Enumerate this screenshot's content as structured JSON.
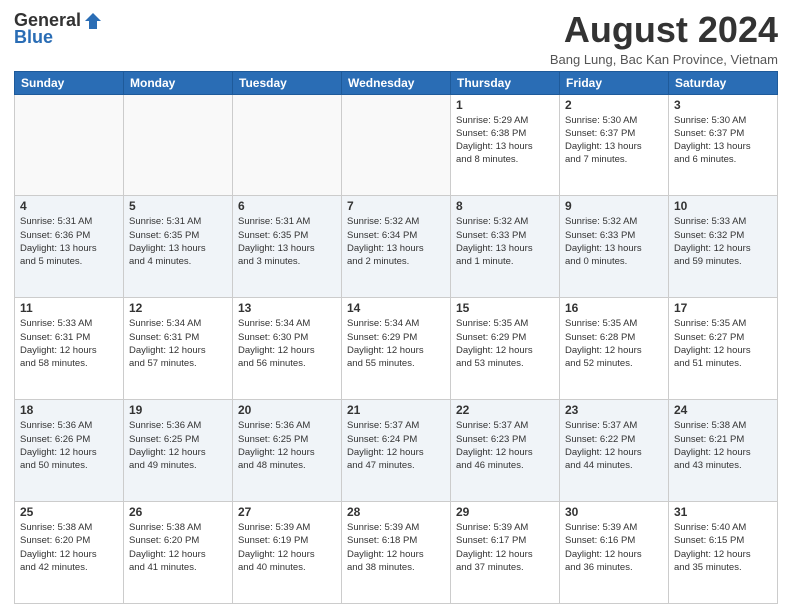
{
  "logo": {
    "general": "General",
    "blue": "Blue"
  },
  "header": {
    "month_year": "August 2024",
    "location": "Bang Lung, Bac Kan Province, Vietnam"
  },
  "days_of_week": [
    "Sunday",
    "Monday",
    "Tuesday",
    "Wednesday",
    "Thursday",
    "Friday",
    "Saturday"
  ],
  "weeks": [
    [
      {
        "num": "",
        "info": ""
      },
      {
        "num": "",
        "info": ""
      },
      {
        "num": "",
        "info": ""
      },
      {
        "num": "",
        "info": ""
      },
      {
        "num": "1",
        "info": "Sunrise: 5:29 AM\nSunset: 6:38 PM\nDaylight: 13 hours\nand 8 minutes."
      },
      {
        "num": "2",
        "info": "Sunrise: 5:30 AM\nSunset: 6:37 PM\nDaylight: 13 hours\nand 7 minutes."
      },
      {
        "num": "3",
        "info": "Sunrise: 5:30 AM\nSunset: 6:37 PM\nDaylight: 13 hours\nand 6 minutes."
      }
    ],
    [
      {
        "num": "4",
        "info": "Sunrise: 5:31 AM\nSunset: 6:36 PM\nDaylight: 13 hours\nand 5 minutes."
      },
      {
        "num": "5",
        "info": "Sunrise: 5:31 AM\nSunset: 6:35 PM\nDaylight: 13 hours\nand 4 minutes."
      },
      {
        "num": "6",
        "info": "Sunrise: 5:31 AM\nSunset: 6:35 PM\nDaylight: 13 hours\nand 3 minutes."
      },
      {
        "num": "7",
        "info": "Sunrise: 5:32 AM\nSunset: 6:34 PM\nDaylight: 13 hours\nand 2 minutes."
      },
      {
        "num": "8",
        "info": "Sunrise: 5:32 AM\nSunset: 6:33 PM\nDaylight: 13 hours\nand 1 minute."
      },
      {
        "num": "9",
        "info": "Sunrise: 5:32 AM\nSunset: 6:33 PM\nDaylight: 13 hours\nand 0 minutes."
      },
      {
        "num": "10",
        "info": "Sunrise: 5:33 AM\nSunset: 6:32 PM\nDaylight: 12 hours\nand 59 minutes."
      }
    ],
    [
      {
        "num": "11",
        "info": "Sunrise: 5:33 AM\nSunset: 6:31 PM\nDaylight: 12 hours\nand 58 minutes."
      },
      {
        "num": "12",
        "info": "Sunrise: 5:34 AM\nSunset: 6:31 PM\nDaylight: 12 hours\nand 57 minutes."
      },
      {
        "num": "13",
        "info": "Sunrise: 5:34 AM\nSunset: 6:30 PM\nDaylight: 12 hours\nand 56 minutes."
      },
      {
        "num": "14",
        "info": "Sunrise: 5:34 AM\nSunset: 6:29 PM\nDaylight: 12 hours\nand 55 minutes."
      },
      {
        "num": "15",
        "info": "Sunrise: 5:35 AM\nSunset: 6:29 PM\nDaylight: 12 hours\nand 53 minutes."
      },
      {
        "num": "16",
        "info": "Sunrise: 5:35 AM\nSunset: 6:28 PM\nDaylight: 12 hours\nand 52 minutes."
      },
      {
        "num": "17",
        "info": "Sunrise: 5:35 AM\nSunset: 6:27 PM\nDaylight: 12 hours\nand 51 minutes."
      }
    ],
    [
      {
        "num": "18",
        "info": "Sunrise: 5:36 AM\nSunset: 6:26 PM\nDaylight: 12 hours\nand 50 minutes."
      },
      {
        "num": "19",
        "info": "Sunrise: 5:36 AM\nSunset: 6:25 PM\nDaylight: 12 hours\nand 49 minutes."
      },
      {
        "num": "20",
        "info": "Sunrise: 5:36 AM\nSunset: 6:25 PM\nDaylight: 12 hours\nand 48 minutes."
      },
      {
        "num": "21",
        "info": "Sunrise: 5:37 AM\nSunset: 6:24 PM\nDaylight: 12 hours\nand 47 minutes."
      },
      {
        "num": "22",
        "info": "Sunrise: 5:37 AM\nSunset: 6:23 PM\nDaylight: 12 hours\nand 46 minutes."
      },
      {
        "num": "23",
        "info": "Sunrise: 5:37 AM\nSunset: 6:22 PM\nDaylight: 12 hours\nand 44 minutes."
      },
      {
        "num": "24",
        "info": "Sunrise: 5:38 AM\nSunset: 6:21 PM\nDaylight: 12 hours\nand 43 minutes."
      }
    ],
    [
      {
        "num": "25",
        "info": "Sunrise: 5:38 AM\nSunset: 6:20 PM\nDaylight: 12 hours\nand 42 minutes."
      },
      {
        "num": "26",
        "info": "Sunrise: 5:38 AM\nSunset: 6:20 PM\nDaylight: 12 hours\nand 41 minutes."
      },
      {
        "num": "27",
        "info": "Sunrise: 5:39 AM\nSunset: 6:19 PM\nDaylight: 12 hours\nand 40 minutes."
      },
      {
        "num": "28",
        "info": "Sunrise: 5:39 AM\nSunset: 6:18 PM\nDaylight: 12 hours\nand 38 minutes."
      },
      {
        "num": "29",
        "info": "Sunrise: 5:39 AM\nSunset: 6:17 PM\nDaylight: 12 hours\nand 37 minutes."
      },
      {
        "num": "30",
        "info": "Sunrise: 5:39 AM\nSunset: 6:16 PM\nDaylight: 12 hours\nand 36 minutes."
      },
      {
        "num": "31",
        "info": "Sunrise: 5:40 AM\nSunset: 6:15 PM\nDaylight: 12 hours\nand 35 minutes."
      }
    ]
  ]
}
